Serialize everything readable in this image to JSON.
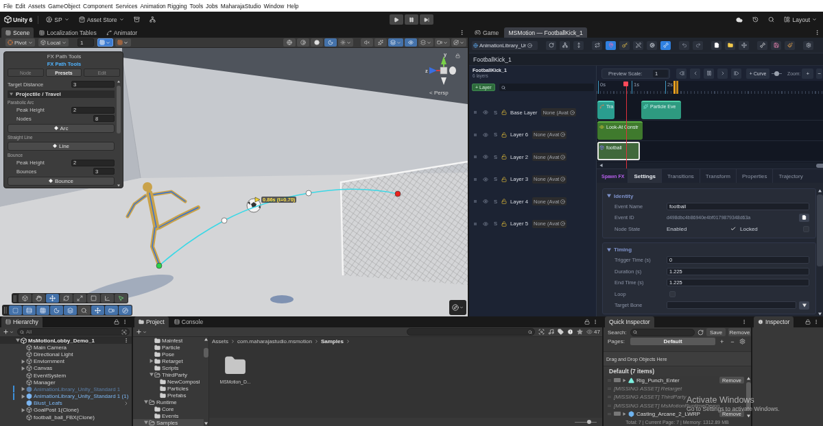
{
  "menu_bar": {
    "items": [
      "File",
      "Edit",
      "Assets",
      "GameObject",
      "Component",
      "Services",
      "Animation Rigging",
      "Tools",
      "Jobs",
      "MaharajaStudio",
      "Window",
      "Help"
    ]
  },
  "main_toolbar": {
    "product": "Unity 6",
    "account": "SP",
    "store": "Asset Store",
    "playback": [
      {
        "kind": "play",
        "selected": false
      },
      {
        "kind": "pause",
        "selected": false
      },
      {
        "kind": "step",
        "selected": false
      }
    ],
    "layout": "Layout"
  },
  "scene_panel": {
    "tabs": [
      {
        "label": "Scene",
        "kind": "scene",
        "selected": true
      },
      {
        "label": "Localization Tables",
        "kind": "table",
        "selected": false
      },
      {
        "label": "Animator",
        "kind": "animator",
        "selected": false
      }
    ],
    "toolbar": {
      "pivot": "Pivot",
      "space": "Local",
      "snap_value": "1",
      "snap_tools": [
        {
          "kind": "grid",
          "selected": true
        },
        {
          "kind": "increment",
          "selected": false
        }
      ],
      "view_tools": [
        [
          {
            "kind": "globe",
            "selected": false,
            "menu": false
          },
          {
            "kind": "shading",
            "selected": false,
            "menu": false
          },
          {
            "kind": "lit",
            "selected": false,
            "menu": false
          },
          {
            "kind": "wire",
            "selected": true,
            "menu": false
          },
          {
            "kind": "lighting",
            "selected": false,
            "menu": true
          }
        ],
        [
          {
            "kind": "audio",
            "selected": false,
            "menu": false
          },
          {
            "kind": "effects",
            "selected": false,
            "menu": false
          },
          {
            "kind": "layers",
            "selected": true,
            "menu": true
          },
          {
            "kind": "visibility",
            "selected": true,
            "menu": false
          },
          {
            "kind": "stack",
            "selected": false,
            "menu": true
          },
          {
            "kind": "camera",
            "selected": false,
            "menu": true
          },
          {
            "kind": "gizmos",
            "selected": false,
            "menu": true
          }
        ]
      ]
    },
    "fx_overlay": {
      "title": "FX Path Tools",
      "subtitle": "FX Path Tools",
      "tabs": [
        {
          "label": "Node",
          "selected": false
        },
        {
          "label": "Presets",
          "selected": true
        },
        {
          "label": "Edit",
          "selected": false
        }
      ],
      "target": {
        "label": "Target Distance",
        "value": "3",
        "kind": "float"
      },
      "section": {
        "title": "Projectile / Travel",
        "expanded": true
      },
      "presets": [
        {
          "title": "Parabolic Arc",
          "fields": [
            {
              "label": "Peak Height",
              "value": "2",
              "kind": "float"
            },
            {
              "label": "Nodes",
              "value": "8",
              "kind": "int"
            }
          ],
          "button": "Arc"
        },
        {
          "title": "Straight Line",
          "button": "Line"
        },
        {
          "title": "Bounce",
          "fields": [
            {
              "label": "Peak Height",
              "value": "2",
              "kind": "float"
            },
            {
              "label": "Bounces",
              "value": "3",
              "kind": "int"
            }
          ],
          "button": "Bounce"
        }
      ]
    },
    "path": {
      "label": "0.86s (t=0.70)",
      "nodes": [
        {
          "kind": "start"
        },
        {
          "kind": "mid"
        },
        {
          "kind": "mid"
        },
        {
          "kind": "end"
        }
      ]
    },
    "gizmo_axes": [
      "y",
      "z"
    ],
    "view_label": "< Persp",
    "tool_rows": [
      [
        {
          "kind": "view",
          "selected": false
        },
        {
          "kind": "hand",
          "selected": false
        },
        {
          "kind": "move",
          "selected": true
        },
        {
          "kind": "rotate",
          "selected": false
        },
        {
          "kind": "scale",
          "selected": false
        },
        {
          "kind": "rect",
          "selected": false
        },
        {
          "kind": "transform",
          "selected": false
        },
        {
          "kind": "custom",
          "selected": false
        }
      ],
      [
        {
          "kind": "frame",
          "selected": true
        },
        {
          "kind": "align",
          "selected": true
        },
        {
          "kind": "grid",
          "selected": true
        },
        {
          "kind": "moon",
          "selected": true
        },
        {
          "kind": "layers",
          "selected": true
        },
        {
          "kind": "search",
          "selected": false
        },
        {
          "kind": "move",
          "selected": true
        },
        {
          "kind": "camera",
          "selected": true
        },
        {
          "kind": "compass",
          "selected": true
        }
      ]
    ]
  },
  "right_panel": {
    "tabs": [
      {
        "label": "Game",
        "kind": "game",
        "selected": false
      },
      {
        "label": "MSMotion — FootballKick_1",
        "kind": "plain",
        "selected": true
      }
    ],
    "library_field": "AnimationLibrary_Ur",
    "tool_groups": [
      [
        {
          "kind": "refresh",
          "selected": false
        },
        {
          "kind": "hierarchy",
          "selected": false
        },
        {
          "kind": "vertical",
          "selected": false
        }
      ],
      [
        {
          "kind": "loop",
          "selected": false
        },
        {
          "kind": "pin",
          "selected": true
        },
        {
          "kind": "key",
          "selected": false
        },
        {
          "kind": "no_pick",
          "selected": false
        },
        {
          "kind": "gear_small",
          "selected": false
        },
        {
          "kind": "bone",
          "selected": true
        }
      ],
      [
        {
          "kind": "undo",
          "selected": false
        },
        {
          "kind": "redo",
          "selected": false
        }
      ],
      [
        {
          "kind": "file",
          "selected": false
        },
        {
          "kind": "folder",
          "selected": false
        },
        {
          "kind": "move",
          "selected": false
        }
      ],
      [
        {
          "kind": "bone",
          "selected": false
        },
        {
          "kind": "save",
          "selected": false
        },
        {
          "kind": "brush",
          "selected": false
        }
      ],
      [
        {
          "kind": "settings",
          "selected": false
        }
      ]
    ],
    "clip_title": "FootballKick_1",
    "layer_header": {
      "title": "FootballKick_1",
      "count": "6 layers",
      "add_button": "+ Layer"
    },
    "preview": {
      "label": "Preview Scale:",
      "value": "1",
      "transport": [
        {
          "kind": "first"
        },
        {
          "kind": "prev"
        },
        {
          "kind": "play"
        },
        {
          "kind": "next"
        },
        {
          "kind": "last"
        }
      ],
      "curve_button": "+ Curve",
      "curve_slider": {
        "level": 0.5
      },
      "zoom_label": "Zoom:",
      "zoom_in": "+",
      "zoom_out": "−"
    },
    "ruler": {
      "ticks": [
        "0s",
        "1s",
        "2s"
      ],
      "playhead": {
        "level": 0.13
      }
    },
    "layers": [
      {
        "name": "Base Layer",
        "solo": "S",
        "avatar": "None (Avat"
      },
      {
        "name": "Layer 6",
        "solo": "S",
        "avatar": "None (Avat"
      },
      {
        "name": "Layer 2",
        "solo": "S",
        "avatar": "None (Avat"
      },
      {
        "name": "Layer 3",
        "solo": "S",
        "avatar": "None (Avat"
      },
      {
        "name": "Layer 4",
        "solo": "S",
        "avatar": "None (Avat"
      },
      {
        "name": "Layer 5",
        "solo": "S",
        "avatar": "None (Avat"
      }
    ],
    "tracks": [
      {
        "clips": [
          {
            "label": "Tra",
            "kind": "trajectory",
            "selected": false
          },
          {
            "label": "Particle Eve",
            "kind": "particle",
            "selected": false
          }
        ]
      },
      {
        "clips": [
          {
            "label": "Look-At Constr",
            "kind": "look_at",
            "selected": false
          }
        ]
      },
      {
        "clips": [
          {
            "label": "football",
            "kind": "spawn",
            "selected": true
          }
        ]
      }
    ],
    "inspector": {
      "event_type": "Spawn FX",
      "tabs": [
        {
          "label": "Settings",
          "selected": true
        },
        {
          "label": "Transitions",
          "selected": false
        },
        {
          "label": "Transform",
          "selected": false
        },
        {
          "label": "Properties",
          "selected": false
        },
        {
          "label": "Trajectory",
          "selected": false
        }
      ],
      "sections": [
        {
          "title": "Identity",
          "expanded": true,
          "rows": [
            {
              "kind": "text",
              "label": "Event Name",
              "value": "football"
            },
            {
              "kind": "id",
              "label": "Event ID",
              "value": "d498dbc4b86940e4bf0179879348d63a"
            },
            {
              "kind": "toggles",
              "label": "Node State",
              "toggles": [
                {
                  "label": "Enabled",
                  "checked": true
                },
                {
                  "label": "Locked",
                  "checked": false
                }
              ]
            }
          ]
        },
        {
          "title": "Timing",
          "expanded": true,
          "rows": [
            {
              "kind": "text",
              "label": "Trigger Time (s)",
              "value": "0"
            },
            {
              "kind": "text",
              "label": "Duration (s)",
              "value": "1.225"
            },
            {
              "kind": "text",
              "label": "End Time (s)",
              "value": "1.225"
            },
            {
              "kind": "checkbox",
              "label": "Loop",
              "checked": false
            },
            {
              "kind": "dropdown",
              "label": "Target Bone"
            }
          ]
        }
      ]
    }
  },
  "hierarchy": {
    "tab": "Hierarchy",
    "search_placeholder": "All",
    "items": [
      {
        "name": "MsMotionLobby_Demo_1",
        "kind": "scene",
        "expanded": true,
        "selected": false,
        "active": true,
        "override": false,
        "arrow": false,
        "children": [
          {
            "name": "Main Camera",
            "kind": "object",
            "selected": false,
            "active": true,
            "override": false,
            "arrow": false
          },
          {
            "name": "Directional Light",
            "kind": "object",
            "selected": false,
            "active": true,
            "override": false,
            "arrow": false
          },
          {
            "name": "Enviornment",
            "kind": "object",
            "expanded": false,
            "selected": false,
            "active": true,
            "override": false,
            "arrow": false
          },
          {
            "name": "Canvas",
            "kind": "object",
            "expanded": false,
            "selected": false,
            "active": true,
            "override": false,
            "arrow": false
          },
          {
            "name": "EventSystem",
            "kind": "object",
            "selected": false,
            "active": true,
            "override": false,
            "arrow": false
          },
          {
            "name": "Manager",
            "kind": "object",
            "selected": false,
            "active": true,
            "override": false,
            "arrow": false
          },
          {
            "name": "AnimationLibrary_Unity_Standard 1",
            "kind": "prefab",
            "expanded": false,
            "selected": false,
            "active": false,
            "override": true,
            "arrow": false
          },
          {
            "name": "AnimationLibrary_Unity_Standard 1 (1)",
            "kind": "prefab",
            "expanded": false,
            "selected": false,
            "active": true,
            "override": true,
            "arrow": false
          },
          {
            "name": "Blust_Leafs",
            "kind": "prefab",
            "selected": false,
            "active": true,
            "override": false,
            "arrow": true
          },
          {
            "name": "GoalPost 1(Clone)",
            "kind": "object",
            "expanded": false,
            "selected": false,
            "active": true,
            "override": false,
            "arrow": false
          },
          {
            "name": "football_ball_FBX(Clone)",
            "kind": "object",
            "selected": false,
            "active": true,
            "override": false,
            "arrow": false
          }
        ]
      }
    ]
  },
  "project": {
    "tabs": [
      {
        "label": "Project",
        "kind": "project",
        "selected": true
      },
      {
        "label": "Console",
        "kind": "console",
        "selected": false
      }
    ],
    "hidden_count": "47",
    "folders": [
      {
        "children": [
          {
            "name": "Mainfest",
            "selected": false
          },
          {
            "name": "Particle",
            "selected": false
          },
          {
            "name": "Pose",
            "selected": false
          },
          {
            "name": "Retarget",
            "expanded": false,
            "selected": false
          },
          {
            "name": "Scripts",
            "selected": false
          },
          {
            "name": "ThirdParty",
            "expanded": true,
            "selected": false,
            "children": [
              {
                "name": "NewComposi",
                "selected": false
              },
              {
                "name": "Particles",
                "selected": false
              },
              {
                "name": "Prefabs",
                "selected": false
              }
            ]
          }
        ]
      },
      {
        "name": "Runtime",
        "expanded": true,
        "selected": false,
        "children": [
          {
            "name": "Core",
            "selected": false
          },
          {
            "name": "Events",
            "selected": false
          }
        ]
      },
      {
        "name": "Samples",
        "expanded": true,
        "selected": true
      }
    ],
    "breadcrumb": [
      "Assets",
      "com.maharajastudio.msmotion",
      "Samples"
    ],
    "items": [
      {
        "name": "MSMotion_D...",
        "kind": "folder"
      }
    ],
    "icon_size": {
      "level": 0.65
    }
  },
  "quick_inspector": {
    "tab": "Quick Inspector",
    "search_label": "Search:",
    "save_button": "Save",
    "remove_button": "Remove",
    "pages_label": "Pages:",
    "page": "Default",
    "add_page": "+",
    "remove_page": "−",
    "drop_hint": "Drag and Drop Objects Here",
    "group_title": "Default (7 items)",
    "items": [
      {
        "kind": "animation",
        "name": "Rig_Punch_Enter",
        "action": "Remove"
      },
      {
        "kind": "missing",
        "name": "[MISSING ASSET] Retarget"
      },
      {
        "kind": "missing",
        "name": "[MISSING ASSET] ThirdParty"
      },
      {
        "kind": "missing",
        "name": "[MISSING ASSET] MsMotionRuntimeDemo"
      },
      {
        "kind": "prefab",
        "name": "Casting_Arcane_2_LWRP",
        "action": "Remove"
      }
    ],
    "footer": "Total: 7 | Current Page: 7 | Memory: 1312.89 MB"
  },
  "inspector": {
    "tab": "Inspector"
  },
  "os_notice": {
    "title": "Activate Windows",
    "detail": "Go to Settings to activate Windows."
  }
}
